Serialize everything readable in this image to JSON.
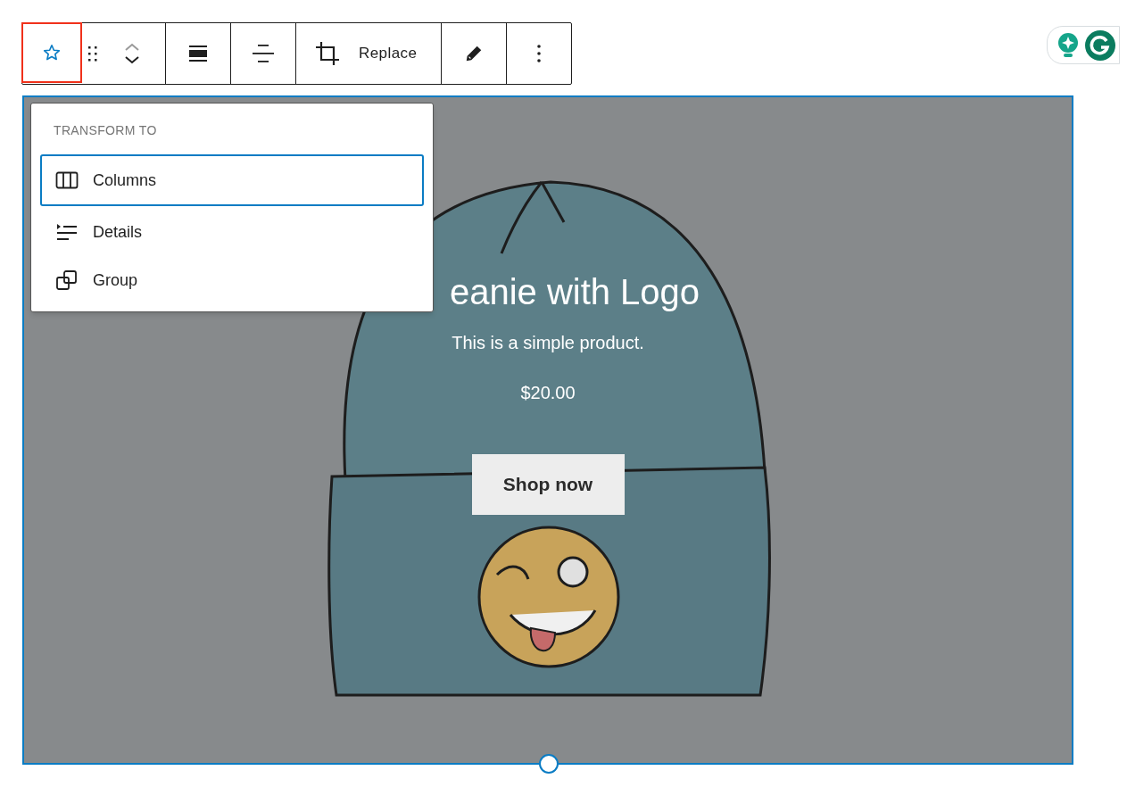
{
  "toolbar": [
    {
      "kind": "star",
      "selected": true
    },
    {
      "kind": "drag"
    },
    {
      "kind": "mover"
    },
    {
      "kind": "align-full"
    },
    {
      "kind": "justify"
    },
    {
      "kind": "crop",
      "label": "Replace"
    },
    {
      "kind": "pencil"
    },
    {
      "kind": "more"
    }
  ],
  "transform_menu": {
    "heading": "TRANSFORM TO",
    "items": [
      {
        "kind": "columns",
        "label": "Columns",
        "selected": true
      },
      {
        "kind": "details",
        "label": "Details",
        "selected": false
      },
      {
        "kind": "group",
        "label": "Group",
        "selected": false
      }
    ]
  },
  "cover": {
    "heading": "eanie with Logo",
    "text": "This is a simple product.",
    "price": "$20.00",
    "button": "Shop now"
  }
}
